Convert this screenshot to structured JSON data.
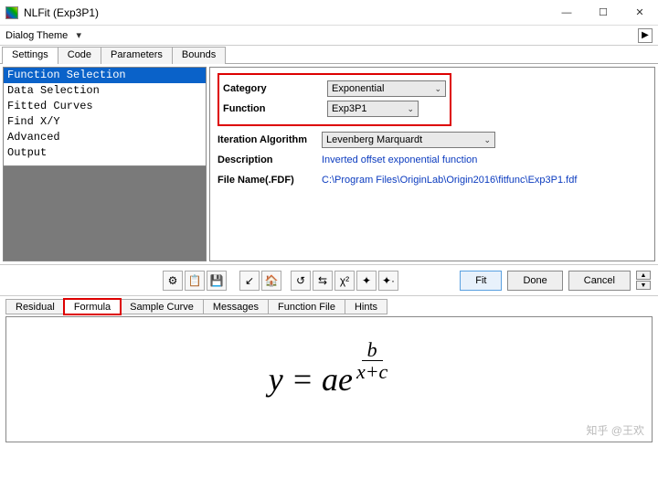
{
  "window": {
    "title": "NLFit (Exp3P1)",
    "min_icon": "—",
    "max_icon": "☐",
    "close_icon": "✕"
  },
  "dialog_theme": {
    "label": "Dialog Theme",
    "dropdown_glyph": "▾",
    "play_glyph": "▶"
  },
  "tabs_top": {
    "items": [
      "Settings",
      "Code",
      "Parameters",
      "Bounds"
    ],
    "active": "Settings"
  },
  "tree": {
    "items": [
      "Function Selection",
      "Data Selection",
      "Fitted Curves",
      "Find X/Y",
      "Advanced",
      "Output"
    ],
    "selected": "Function Selection"
  },
  "right": {
    "category_label": "Category",
    "category_value": "Exponential",
    "function_label": "Function",
    "function_value": "Exp3P1",
    "iter_label": "Iteration Algorithm",
    "iter_value": "Levenberg Marquardt",
    "desc_label": "Description",
    "desc_value": "Inverted offset exponential function",
    "file_label": "File Name(.FDF)",
    "file_value": "C:\\Program Files\\OriginLab\\Origin2016\\fitfunc\\Exp3P1.fdf",
    "chev": "⌄"
  },
  "toolbar": {
    "icons": [
      "tool-a",
      "tool-b",
      "tool-c",
      "tool-d",
      "tool-e",
      "tool-f",
      "tool-g",
      "tool-h",
      "tool-i",
      "tool-j"
    ],
    "glyphs": [
      "⚙",
      "📋",
      "💾",
      "↙",
      "🏠",
      "↺",
      "⇆",
      "χ²",
      "✦",
      "✦·"
    ],
    "fit": "Fit",
    "done": "Done",
    "cancel": "Cancel",
    "spin_up": "▲",
    "spin_down": "▼"
  },
  "tabs_bottom": {
    "items": [
      "Residual",
      "Formula",
      "Sample Curve",
      "Messages",
      "Function File",
      "Hints"
    ],
    "active": "Formula"
  },
  "formula": {
    "lhs": "y = ae",
    "num": "b",
    "den": "x+c"
  },
  "watermark": "知乎 @王欢"
}
